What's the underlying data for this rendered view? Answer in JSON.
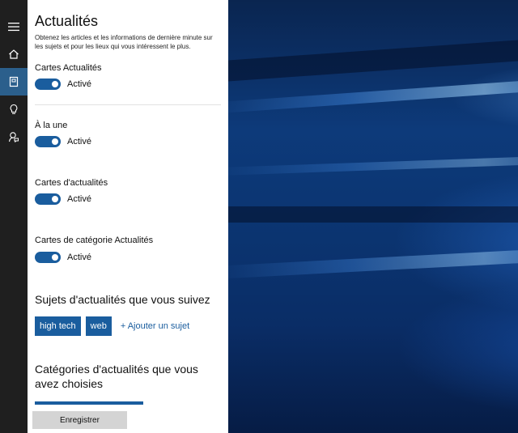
{
  "rail": {
    "items": [
      {
        "icon": "hamburger-menu-icon"
      },
      {
        "icon": "home-icon"
      },
      {
        "icon": "notebook-icon"
      },
      {
        "icon": "lightbulb-icon"
      },
      {
        "icon": "feedback-icon"
      }
    ],
    "active_index": 2
  },
  "panel": {
    "title": "Actualités",
    "description": "Obtenez les articles et les informations de dernière minute sur les sujets et pour les lieux qui vous intéressent le plus.",
    "toggles": [
      {
        "label": "Cartes Actualités",
        "state": "Activé"
      },
      {
        "label": "À la une",
        "state": "Activé"
      },
      {
        "label": "Cartes d'actualités",
        "state": "Activé"
      },
      {
        "label": "Cartes de catégorie Actualités",
        "state": "Activé"
      }
    ],
    "topics_heading": "Sujets d'actualités que vous suivez",
    "topics": [
      "high tech",
      "web"
    ],
    "add_topic": "+ Ajouter un sujet",
    "categories_heading": "Catégories d'actualités que vous avez choisies",
    "save_label": "Enregistrer"
  },
  "colors": {
    "accent": "#1a5d9e",
    "rail_bg": "#1f1f1f",
    "rail_active": "#2b5f8c",
    "panel_bg": "#ffffff"
  }
}
